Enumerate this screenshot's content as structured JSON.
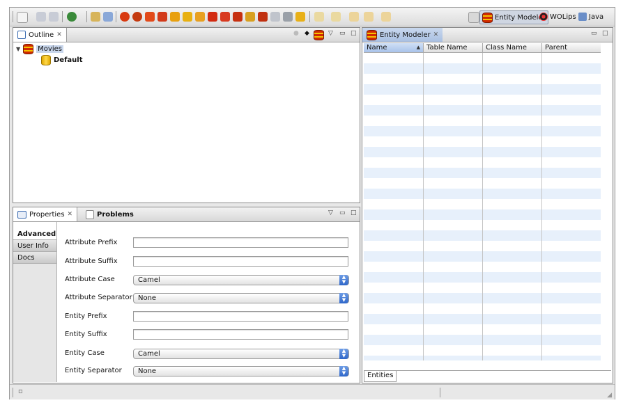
{
  "toolbar": {
    "perspectives": [
      {
        "label": "Entity Modeler",
        "icon": "entity-modeler-icon",
        "active": true
      },
      {
        "label": "WOLips",
        "icon": "wolips-icon",
        "active": false
      },
      {
        "label": "Java",
        "icon": "java-icon",
        "active": false
      }
    ]
  },
  "outline": {
    "tab_label": "Outline",
    "tree": [
      {
        "label": "Movies",
        "icon": "eomodel-icon",
        "expanded": true,
        "selected": true
      },
      {
        "label": "Default",
        "icon": "database-config-icon"
      }
    ]
  },
  "properties": {
    "tabs": [
      "Properties",
      "Problems"
    ],
    "side_tabs": [
      "Advanced",
      "User Info",
      "Docs"
    ],
    "fields": [
      {
        "label": "Attribute Prefix",
        "type": "text",
        "value": ""
      },
      {
        "label": "Attribute Suffix",
        "type": "text",
        "value": ""
      },
      {
        "label": "Attribute Case",
        "type": "select",
        "value": "Camel"
      },
      {
        "label": "Attribute Separator",
        "type": "select",
        "value": "None"
      },
      {
        "label": "Entity Prefix",
        "type": "text",
        "value": ""
      },
      {
        "label": "Entity Suffix",
        "type": "text",
        "value": ""
      },
      {
        "label": "Entity Case",
        "type": "select",
        "value": "Camel"
      },
      {
        "label": "Entity Separator",
        "type": "select",
        "value": "None"
      }
    ]
  },
  "editor": {
    "tab_label": "Entity Modeler",
    "columns": [
      "Name",
      "Table Name",
      "Class Name",
      "Parent"
    ],
    "sort_column": "Name",
    "bottom_tab": "Entities",
    "stripe_color": "#e7f0fb"
  }
}
